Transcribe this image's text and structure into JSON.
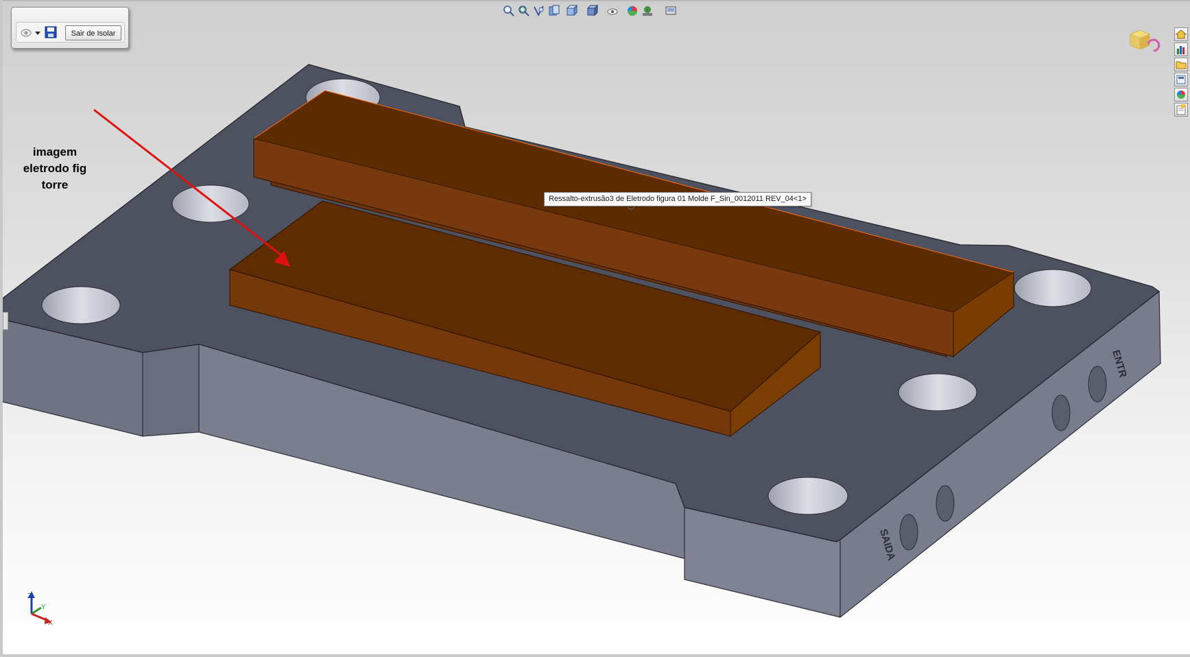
{
  "isolate_toolbar": {
    "exit_button_label": "Sair de Isolar",
    "icons": [
      "visibility-dropdown-icon",
      "save-disk-icon"
    ]
  },
  "heads_up_toolbar": {
    "icons": [
      "zoom-to-fit-icon",
      "zoom-area-icon",
      "previous-view-icon",
      "section-view-icon",
      "view-orientation-icon",
      "display-style-icon",
      "hide-show-items-icon",
      "edit-appearance-icon",
      "apply-scene-icon",
      "view-settings-icon"
    ]
  },
  "tooltip": {
    "text": "Ressalto-extrusão3 de Eletrodo figura 01 Molde F_Sin_0012011 REV_04<1>"
  },
  "annotation": {
    "lines": [
      "imagem",
      "eletrodo fig",
      "torre"
    ],
    "arrow_color": "#e01010"
  },
  "model": {
    "engraved_labels": [
      "ENTR",
      "SAIDA"
    ],
    "colors": {
      "plate_top": "#4f5261",
      "plate_side": "#7c7f90",
      "electrode_top": "#5e2c00",
      "electrode_side": "#7a3b0c",
      "hole": "#c9cbd4"
    }
  },
  "triad": {
    "axes": [
      "Z",
      "Y",
      "X"
    ],
    "colors": {
      "Z": "#1f3fae",
      "Y": "#2f9a2f",
      "X": "#c81f1f"
    }
  },
  "task_pane": {
    "icons": [
      "home-icon",
      "design-library-icon",
      "file-explorer-icon",
      "view-palette-icon",
      "appearances-icon",
      "custom-properties-icon"
    ]
  },
  "view_cube_icon": "view-cube-icon"
}
